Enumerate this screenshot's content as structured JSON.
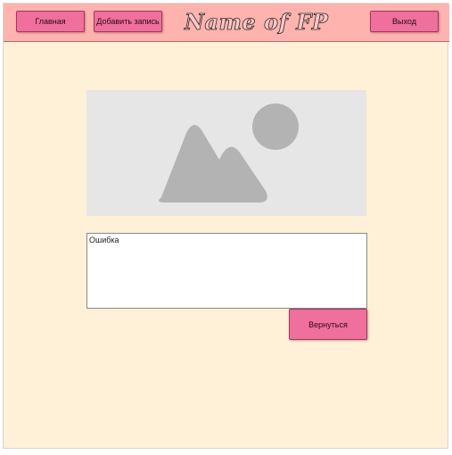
{
  "header": {
    "home_label": "Главная",
    "add_label": "Добавить запись",
    "logo_text": "Name of FP",
    "exit_label": "Выход"
  },
  "main": {
    "image_icon": "image-placeholder-icon",
    "message_text": "Ошибка",
    "back_label": "Вернуться"
  },
  "colors": {
    "page_background": "#fff0d8",
    "header_background": "#ffb3ae",
    "button_background": "#ef6f9d",
    "placeholder_background": "#e6e6e6",
    "placeholder_shape": "#b3b3b3"
  }
}
